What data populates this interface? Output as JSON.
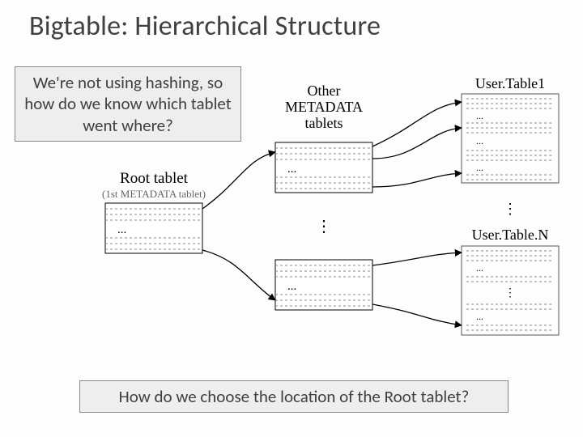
{
  "title": "Bigtable: Hierarchical Structure",
  "callouts": {
    "top": "We're not using hashing, so how do we know which tablet went where?",
    "bottom": "How do we choose the location of the Root tablet?"
  },
  "diagram": {
    "root_label": "Root tablet",
    "root_sublabel": "(1st METADATA tablet)",
    "metadata_label_line1": "Other",
    "metadata_label_line2": "METADATA",
    "metadata_label_line3": "tablets",
    "user_top_label": "User.Table1",
    "user_bottom_label": "User.Table.N",
    "ellipsis": "...",
    "vdots": "⋮"
  }
}
